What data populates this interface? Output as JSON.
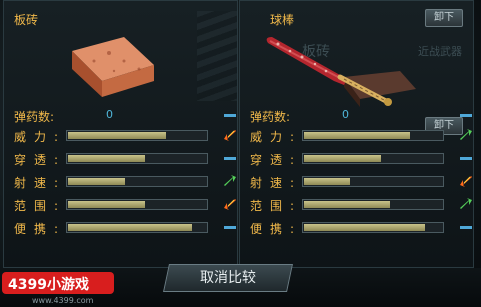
{
  "left_weapon": {
    "name": "板砖",
    "icon": "brick-icon",
    "stats": [
      {
        "label": "弹药数:",
        "value": "0",
        "kind": "ammo",
        "indicator": "equal-icon"
      },
      {
        "label": "威力:",
        "fill": 0.71,
        "indicator": "down-icon"
      },
      {
        "label": "穿透:",
        "fill": 0.56,
        "indicator": "equal-icon"
      },
      {
        "label": "射速:",
        "fill": 0.41,
        "indicator": "up-icon"
      },
      {
        "label": "范围:",
        "fill": 0.56,
        "indicator": "down-icon"
      },
      {
        "label": "便携:",
        "fill": 0.9,
        "indicator": "equal-icon"
      }
    ]
  },
  "right_weapon": {
    "name": "球棒",
    "icon": "baseball-bat-icon",
    "bg_name": "板砖",
    "bg_type": "近战武器",
    "unload_top": "卸下",
    "unload_mid": "卸下",
    "stats": [
      {
        "label": "弹药数:",
        "value": "0",
        "kind": "ammo",
        "indicator": "equal-icon"
      },
      {
        "label": "威力:",
        "fill": 0.77,
        "indicator": "up-icon"
      },
      {
        "label": "穿透:",
        "fill": 0.56,
        "indicator": "equal-icon"
      },
      {
        "label": "射速:",
        "fill": 0.33,
        "indicator": "down-icon"
      },
      {
        "label": "范围:",
        "fill": 0.62,
        "indicator": "up-icon"
      },
      {
        "label": "便携:",
        "fill": 0.88,
        "indicator": "equal-icon"
      }
    ]
  },
  "cancel_button": "取消比较",
  "logo_text": "4399小游戏",
  "logo_url": "www.4399.com",
  "colors": {
    "label": "#f0b84a",
    "value": "#4fb6d9",
    "up": "#55d05a",
    "down": "#ff6a1a",
    "equal": "#4fa8d8"
  }
}
